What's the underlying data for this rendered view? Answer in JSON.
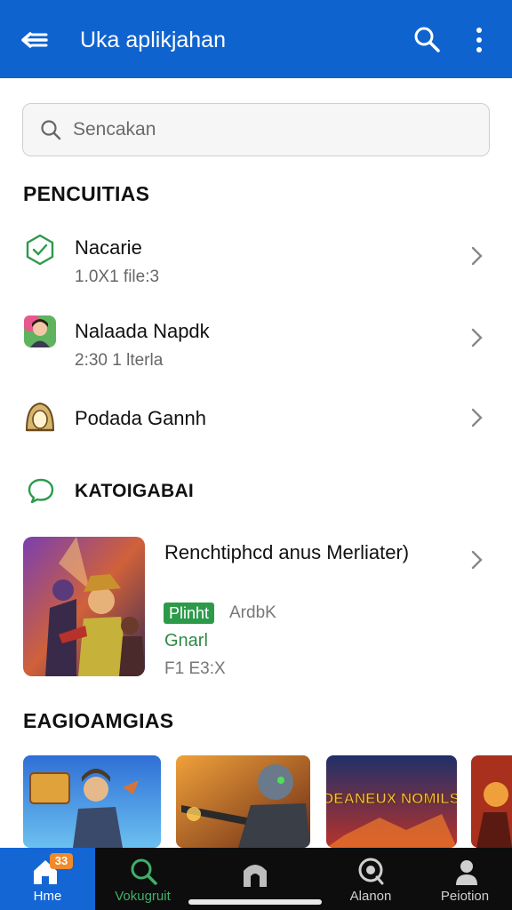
{
  "appbar": {
    "title": "Uka aplikjahan",
    "back_icon": "arrow-left-icon",
    "search_icon": "search-icon",
    "more_icon": "more-vertical-icon"
  },
  "search": {
    "placeholder": "Sencakan"
  },
  "sections": {
    "recent": "PENCUITIAS",
    "category": "KATOIGABAI",
    "games": "EAGIOAMGIAS"
  },
  "recent_items": [
    {
      "title": "Nacarie",
      "subtitle": "1.0X1 file:3",
      "icon": "app-shape-icon"
    },
    {
      "title": "Nalaada Napdk",
      "subtitle": "2:30 1 lterla",
      "icon": "avatar-icon"
    },
    {
      "title": "Podada Gannh",
      "subtitle": "",
      "icon": "game-logo-icon"
    }
  ],
  "featured": {
    "title": "Renchtiphcd anus Merliater)",
    "badge": "Plinht",
    "badge_side": "ArdbK",
    "category": "Gnarl",
    "meta": "F1 E3:X"
  },
  "tiles": [
    {
      "icon": "game-thumbnail-icon"
    },
    {
      "icon": "game-thumbnail-icon"
    },
    {
      "icon": "game-thumbnail-icon",
      "text": "DEANEUX NOMILS"
    },
    {
      "icon": "game-thumbnail-icon"
    }
  ],
  "nav": {
    "home": {
      "label": "Hme",
      "badge": "33"
    },
    "discover": {
      "label": "Vokugruit"
    },
    "house": {
      "label": ""
    },
    "library": {
      "label": "Alanon"
    },
    "profile": {
      "label": "Peiotion"
    }
  },
  "colors": {
    "primary": "#0f63cf",
    "accent_green": "#2d9a4a",
    "nav_bg": "#0d0d0d",
    "badge_orange": "#f08a2c"
  }
}
